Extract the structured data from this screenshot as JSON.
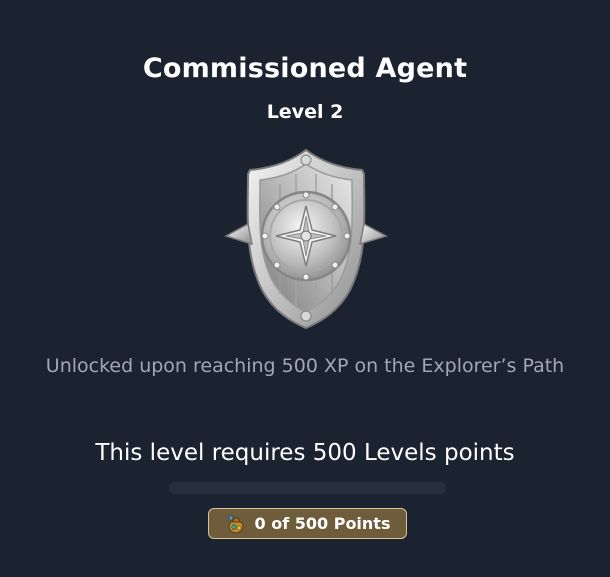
{
  "achievement": {
    "title": "Commissioned Agent",
    "level_label": "Level 2",
    "badge_icon": "silver-shield-compass-badge-icon",
    "description": "Unlocked upon reaching 500 XP on the Explorer’s Path",
    "requirement_text": "This level requires 500 Levels points"
  },
  "progress": {
    "current": 0,
    "total": 500,
    "fraction": 0,
    "points_text": "0 of 500 Points",
    "points_icon": "treasure-pouch-icon"
  },
  "colors": {
    "background": "#1b2331",
    "track": "#262f3e",
    "pill_background": "#6f5c3a",
    "pill_border": "#d6c59a",
    "description_text": "#a2a8b2"
  }
}
